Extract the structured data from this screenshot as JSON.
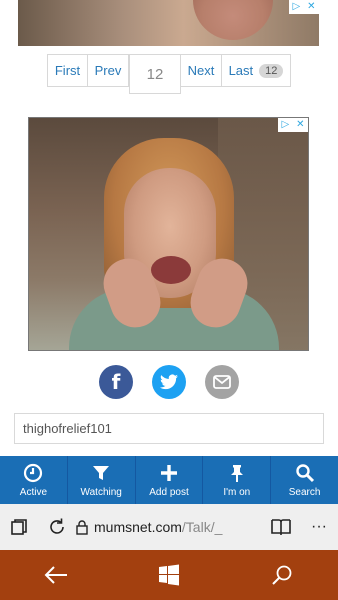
{
  "pagination": {
    "first": "First",
    "prev": "Prev",
    "current": "12",
    "next": "Next",
    "last": "Last",
    "last_badge": "12"
  },
  "ads": {
    "choices_info": "▷",
    "choices_close": "✕"
  },
  "share": {
    "facebook_glyph": "f"
  },
  "username": "thighofrelief101",
  "actions": [
    {
      "label": "Active",
      "icon": "clock-icon"
    },
    {
      "label": "Watching",
      "icon": "filter-icon"
    },
    {
      "label": "Add post",
      "icon": "plus-icon"
    },
    {
      "label": "I'm on",
      "icon": "pin-icon"
    },
    {
      "label": "Search",
      "icon": "search-icon"
    }
  ],
  "browser": {
    "url_domain": "mumsnet.com",
    "url_path": "/Talk/_",
    "more": "···"
  },
  "colors": {
    "action_bar": "#1a6eb5",
    "nav_bar": "#a3400f",
    "facebook": "#3b5998",
    "twitter": "#1da1f2",
    "email": "#a3a3a3"
  }
}
